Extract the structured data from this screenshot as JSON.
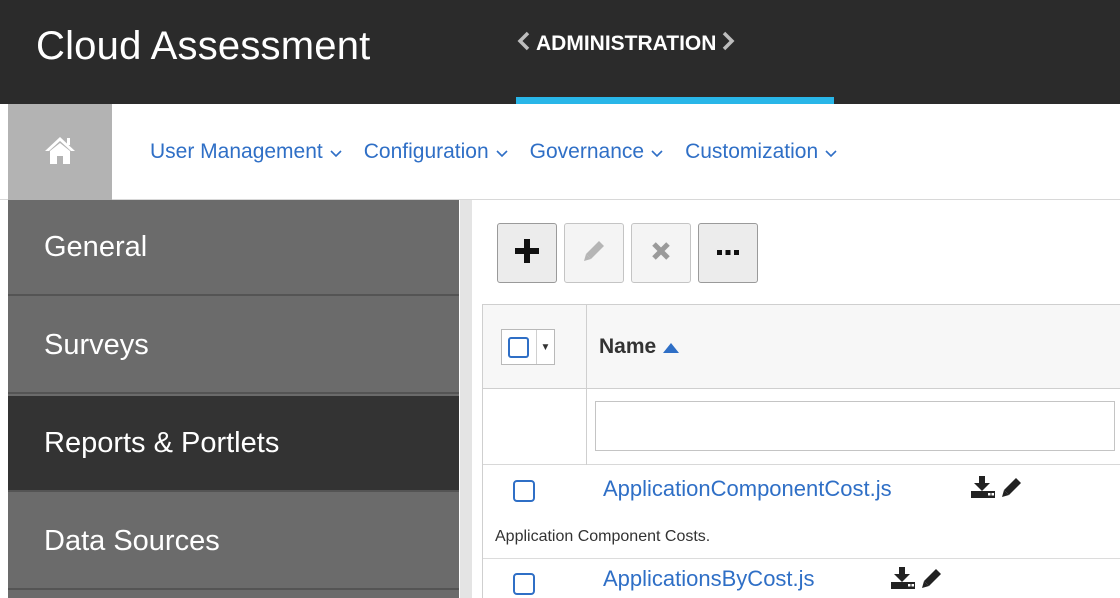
{
  "header": {
    "app_title": "Cloud Assessment",
    "module_label": "ADMINISTRATION",
    "accent_color": "#29b6e8"
  },
  "nav": {
    "home_icon": "home-icon",
    "items": [
      {
        "label": "User Management"
      },
      {
        "label": "Configuration"
      },
      {
        "label": "Governance"
      },
      {
        "label": "Customization"
      }
    ]
  },
  "sidebar": {
    "items": [
      {
        "label": "General",
        "active": false
      },
      {
        "label": "Surveys",
        "active": false
      },
      {
        "label": "Reports & Portlets",
        "active": true
      },
      {
        "label": "Data Sources",
        "active": false
      }
    ]
  },
  "toolbar": {
    "buttons": [
      "plus-icon",
      "pencil-icon",
      "x-icon",
      "ellipsis-icon"
    ]
  },
  "grid": {
    "header": {
      "name_label": "Name",
      "sort": "ascending"
    },
    "filter": {
      "value": ""
    },
    "rows": [
      {
        "name": "ApplicationComponentCost.js",
        "description": "Application Component Costs."
      },
      {
        "name": "ApplicationsByCost.js",
        "description": ""
      }
    ]
  },
  "colors": {
    "header_bg": "#2b2b2b",
    "link": "#2f6fc6",
    "sidebar_bg": "#6b6b6b",
    "sidebar_active": "#333333"
  }
}
